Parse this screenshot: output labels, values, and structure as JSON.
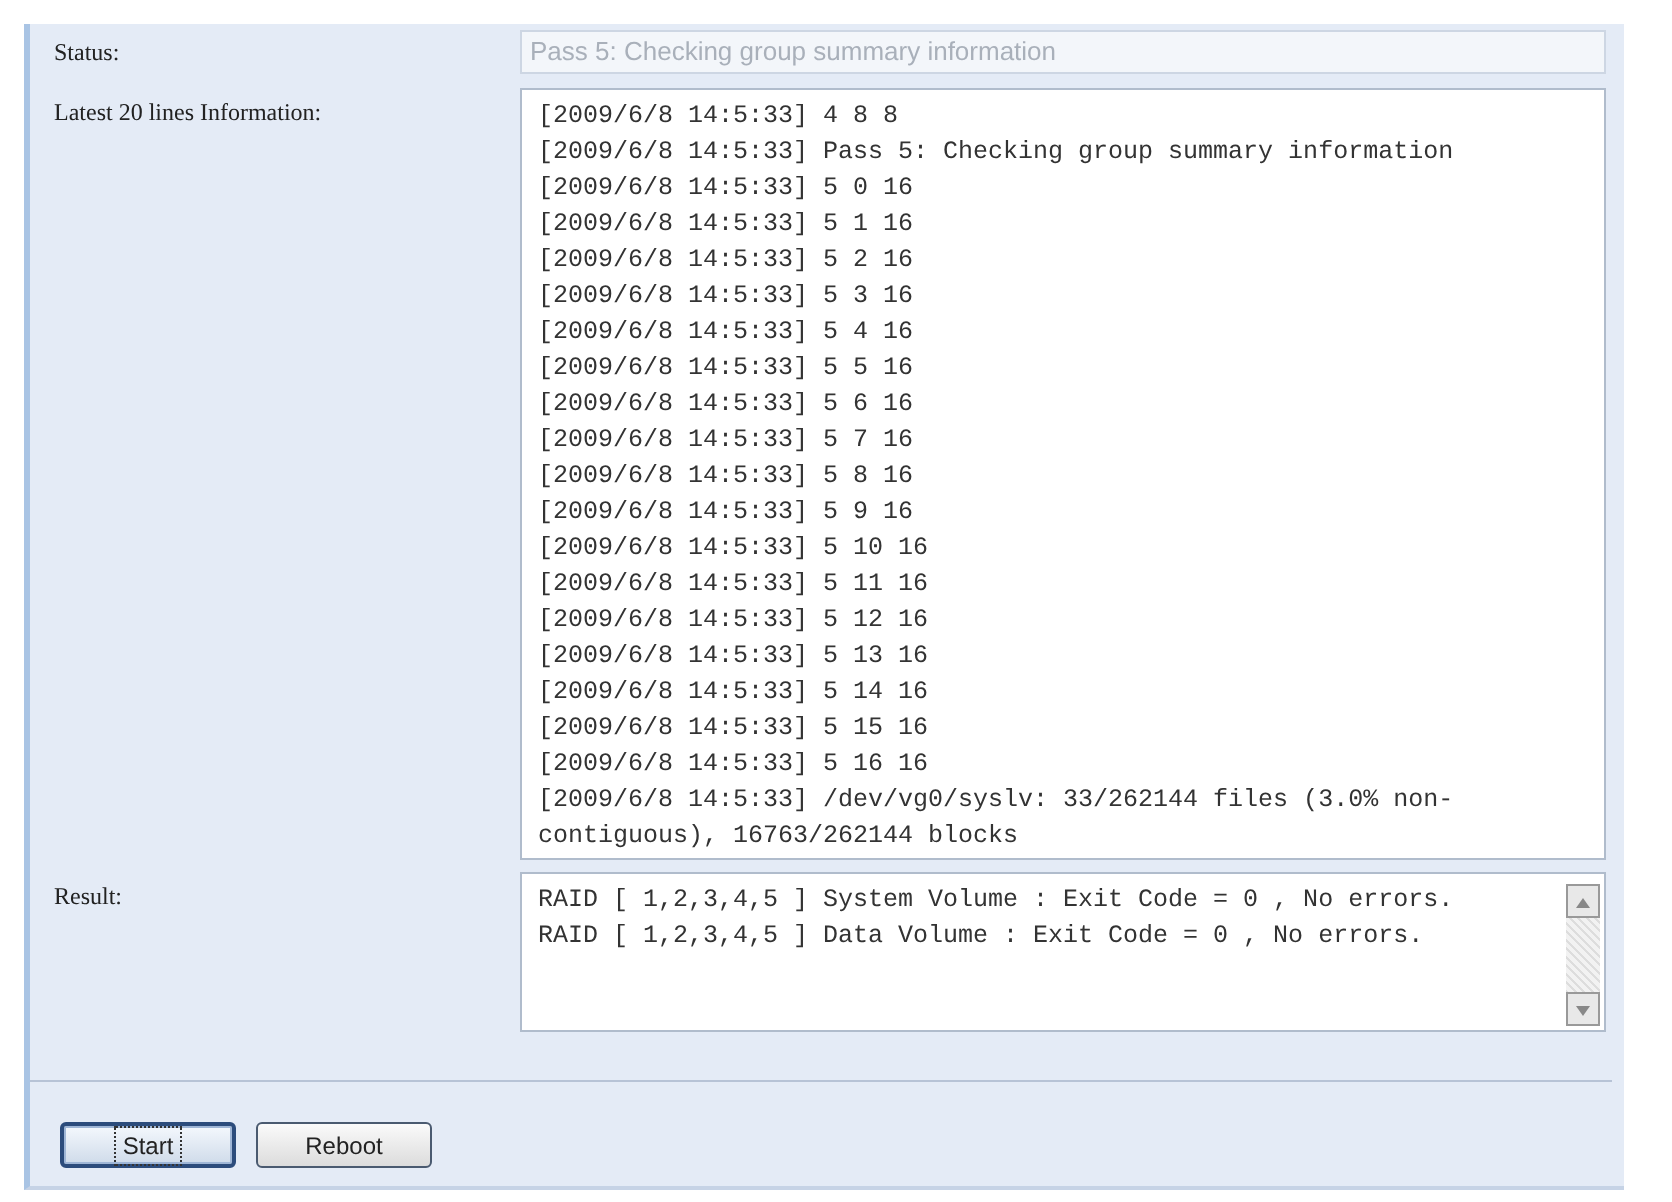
{
  "form": {
    "status": {
      "label": "Status:",
      "value": "Pass 5: Checking group summary information",
      "disabled": true
    },
    "info": {
      "label": "Latest 20 lines Information:",
      "lines": [
        "[2009/6/8 14:5:33] 4 8 8",
        "[2009/6/8 14:5:33] Pass 5: Checking group summary information",
        "[2009/6/8 14:5:33] 5 0 16",
        "[2009/6/8 14:5:33] 5 1 16",
        "[2009/6/8 14:5:33] 5 2 16",
        "[2009/6/8 14:5:33] 5 3 16",
        "[2009/6/8 14:5:33] 5 4 16",
        "[2009/6/8 14:5:33] 5 5 16",
        "[2009/6/8 14:5:33] 5 6 16",
        "[2009/6/8 14:5:33] 5 7 16",
        "[2009/6/8 14:5:33] 5 8 16",
        "[2009/6/8 14:5:33] 5 9 16",
        "[2009/6/8 14:5:33] 5 10 16",
        "[2009/6/8 14:5:33] 5 11 16",
        "[2009/6/8 14:5:33] 5 12 16",
        "[2009/6/8 14:5:33] 5 13 16",
        "[2009/6/8 14:5:33] 5 14 16",
        "[2009/6/8 14:5:33] 5 15 16",
        "[2009/6/8 14:5:33] 5 16 16",
        "[2009/6/8 14:5:33] /dev/vg0/syslv: 33/262144 files (3.0% non-contiguous), 16763/262144 blocks"
      ]
    },
    "result": {
      "label": "Result:",
      "lines": [
        "RAID [ 1,2,3,4,5 ] System Volume : Exit Code = 0 , No errors.",
        "RAID [ 1,2,3,4,5 ] Data Volume : Exit Code = 0 , No errors."
      ]
    }
  },
  "buttons": [
    {
      "label": "Start",
      "focused": true
    },
    {
      "label": "Reboot",
      "focused": false
    }
  ]
}
